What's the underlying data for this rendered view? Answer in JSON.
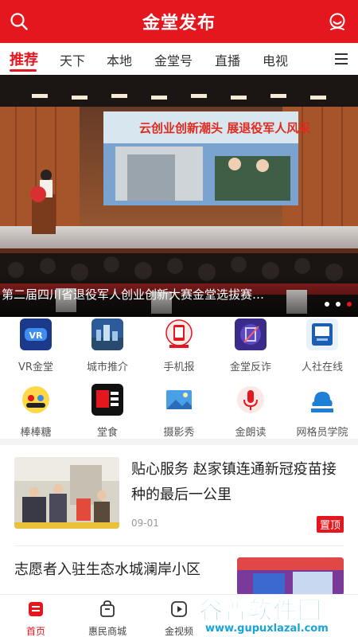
{
  "header": {
    "title": "金堂发布"
  },
  "tabs": [
    {
      "label": "推荐"
    },
    {
      "label": "天下"
    },
    {
      "label": "本地"
    },
    {
      "label": "金堂号"
    },
    {
      "label": "直播"
    },
    {
      "label": "电视"
    }
  ],
  "banner": {
    "caption": "第二届四川省退役军人创业创新大赛金堂选拔赛…",
    "screen_text": "云创业创新潮头 展退役军人风采",
    "screen_subtitle": "第二届四川省退役军人创业创新大赛金堂选拔赛",
    "slide_count": 3,
    "active_slide": 3
  },
  "grid": [
    {
      "label": "VR金堂",
      "icon": "vr-icon"
    },
    {
      "label": "城市推介",
      "icon": "city-icon"
    },
    {
      "label": "手机报",
      "icon": "phone-news-icon"
    },
    {
      "label": "金堂反诈",
      "icon": "anti-fraud-icon"
    },
    {
      "label": "人社在线",
      "icon": "hr-online-icon"
    },
    {
      "label": "棒棒糖",
      "icon": "lollipop-icon"
    },
    {
      "label": "堂食",
      "icon": "food-icon"
    },
    {
      "label": "摄影秀",
      "icon": "photo-icon"
    },
    {
      "label": "金朗读",
      "icon": "reading-icon"
    },
    {
      "label": "网格员学院",
      "icon": "grid-college-icon"
    }
  ],
  "news": [
    {
      "title": "贴心服务  赵家镇连通新冠疫苗接种的最后一公里",
      "date": "09-01",
      "badge": "置顶"
    },
    {
      "title": "志愿者入驻生态水城澜岸小区"
    }
  ],
  "bottom_nav": [
    {
      "label": "首页"
    },
    {
      "label": "惠民商城"
    },
    {
      "label": "金视频"
    }
  ],
  "watermark": {
    "main": "谷普软件园",
    "url": "www.gupuxlazal.com"
  },
  "colors": {
    "brand_red": "#e4161e",
    "watermark_blue": "#1aa3d6"
  }
}
